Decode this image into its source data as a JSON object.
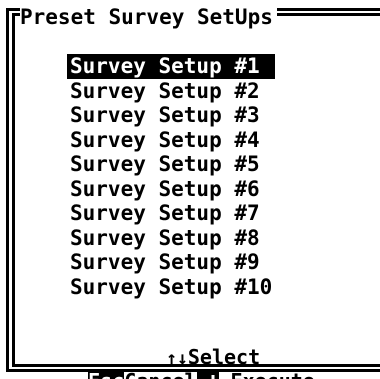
{
  "dialog": {
    "title": "Preset Survey SetUps"
  },
  "presets": [
    {
      "label": "Survey Setup #1",
      "selected": true
    },
    {
      "label": "Survey Setup #2",
      "selected": false
    },
    {
      "label": "Survey Setup #3",
      "selected": false
    },
    {
      "label": "Survey Setup #4",
      "selected": false
    },
    {
      "label": "Survey Setup #5",
      "selected": false
    },
    {
      "label": "Survey Setup #6",
      "selected": false
    },
    {
      "label": "Survey Setup #7",
      "selected": false
    },
    {
      "label": "Survey Setup #8",
      "selected": false
    },
    {
      "label": "Survey Setup #9",
      "selected": false
    },
    {
      "label": "Survey Setup #10",
      "selected": false
    }
  ],
  "help": {
    "select_keys": "↑↓",
    "select_label": "Select",
    "cancel_key": "Esc",
    "cancel_label": "Cancel",
    "execute_key_icon": "enter-key-icon",
    "execute_label": "Execute"
  },
  "colors": {
    "background": "#ffffff",
    "foreground": "#000000",
    "highlight_bg": "#000000",
    "highlight_fg": "#ffffff"
  }
}
